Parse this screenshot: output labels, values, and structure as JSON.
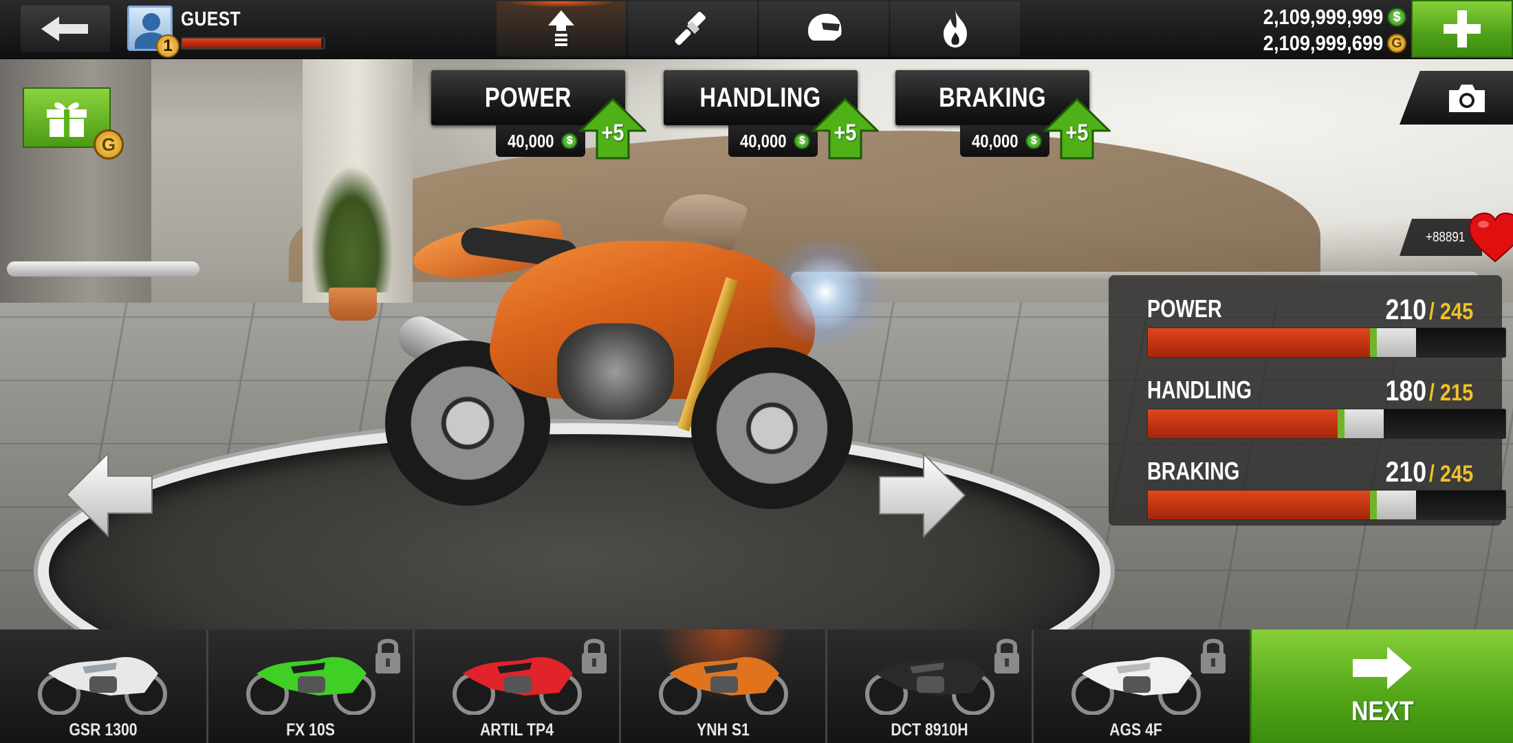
{
  "player": {
    "name": "GUEST",
    "level": "1",
    "xp_progress": 0.98
  },
  "top_tabs": [
    {
      "id": "upgrade",
      "icon": "upgrade-arrow-icon",
      "active": true
    },
    {
      "id": "paint",
      "icon": "paint-brush-icon",
      "active": false
    },
    {
      "id": "tuning",
      "icon": "helmet-icon",
      "active": false
    },
    {
      "id": "nitro",
      "icon": "flame-icon",
      "active": false
    }
  ],
  "currency": {
    "cash": "2,109,999,999",
    "gold": "2,109,999,699",
    "cash_symbol": "$",
    "gold_symbol": "G"
  },
  "upgrades": [
    {
      "label": "POWER",
      "price": "40,000",
      "bonus": "+5"
    },
    {
      "label": "HANDLING",
      "price": "40,000",
      "bonus": "+5"
    },
    {
      "label": "BRAKING",
      "price": "40,000",
      "bonus": "+5"
    }
  ],
  "gift": {
    "badge": "G"
  },
  "likes": {
    "count": "+88891"
  },
  "stats": [
    {
      "name": "POWER",
      "current": "210",
      "max": "/ 245",
      "fill": 0.64,
      "potential": 0.75
    },
    {
      "name": "HANDLING",
      "current": "180",
      "max": "/ 215",
      "fill": 0.55,
      "potential": 0.66
    },
    {
      "name": "BRAKING",
      "current": "210",
      "max": "/ 245",
      "fill": 0.64,
      "potential": 0.75
    }
  ],
  "bikes": [
    {
      "name": "GSR 1300",
      "color": "#e8e8e8",
      "accent": "#9aa3ad",
      "locked": false,
      "selected": false
    },
    {
      "name": "FX 10S",
      "color": "#3fcf25",
      "accent": "#1f1f1f",
      "locked": true,
      "selected": false
    },
    {
      "name": "ARTIL TP4",
      "color": "#e1232a",
      "accent": "#1f1f1f",
      "locked": true,
      "selected": false
    },
    {
      "name": "YNH S1",
      "color": "#e0741e",
      "accent": "#3a3a3a",
      "locked": false,
      "selected": true
    },
    {
      "name": "DCT 8910H",
      "color": "#2a2a2a",
      "accent": "#555555",
      "locked": true,
      "selected": false
    },
    {
      "name": "AGS 4F",
      "color": "#f0f0f0",
      "accent": "#b9b9b9",
      "locked": true,
      "selected": false
    }
  ],
  "next_button": {
    "label": "NEXT"
  },
  "colors": {
    "accent_green": "#5cb31c",
    "bar_red": "#c8330f",
    "stat_max_yellow": "#f2c026",
    "selected_glow": "#ff5a14"
  }
}
